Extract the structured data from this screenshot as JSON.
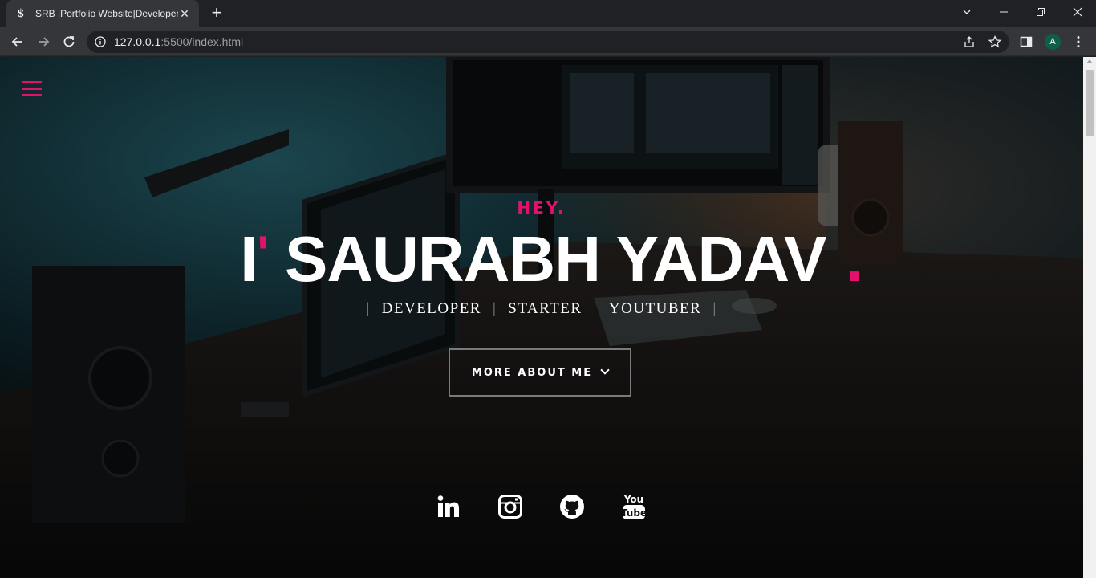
{
  "browser": {
    "tab": {
      "title": "SRB |Portfolio Website|Developer",
      "favicon": "$"
    },
    "url": {
      "host": "127.0.0.1",
      "path": ":5500/index.html"
    },
    "profile_initial": "A"
  },
  "hero": {
    "greeting": "HEY.",
    "name_prefix": "I",
    "apostrophe": "'",
    "name": " SAURABH YADAV",
    "dot": ".",
    "roles": [
      "DEVELOPER",
      "STARTER",
      "YOUTUBER"
    ],
    "separator": "|",
    "cta_label": "MORE ABOUT ME"
  },
  "social": [
    {
      "icon": "linkedin-icon"
    },
    {
      "icon": "instagram-icon"
    },
    {
      "icon": "github-icon"
    },
    {
      "icon": "youtube-icon"
    }
  ],
  "colors": {
    "accent": "#e3116c",
    "text": "#ffffff",
    "chrome_bg": "#202124",
    "toolbar_bg": "#35363a"
  }
}
